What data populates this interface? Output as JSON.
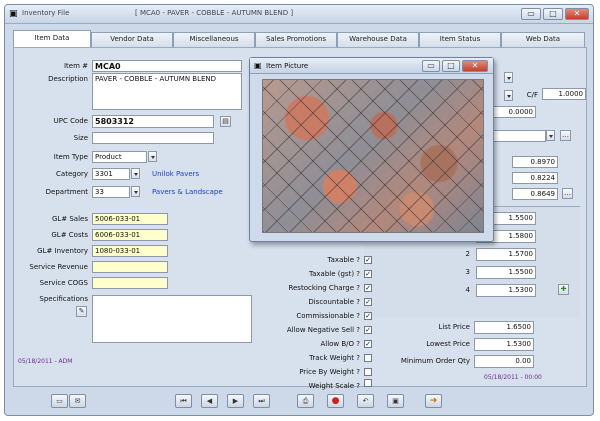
{
  "window": {
    "title": "Inventory File",
    "subtitle": "[ MCA0 - PAVER - COBBLE - AUTUMN BLEND ]"
  },
  "tabs": [
    "Item Data",
    "Vendor Data",
    "Miscellaneous",
    "Sales Promotions",
    "Warehouse Data",
    "Item Status",
    "Web Data"
  ],
  "left_form": {
    "item_no": {
      "label": "Item #",
      "value": "MCA0"
    },
    "description": {
      "label": "Description",
      "value": "PAVER - COBBLE - AUTUMN BLEND"
    },
    "upc": {
      "label": "UPC Code",
      "value": "5803312"
    },
    "size": {
      "label": "Size",
      "value": ""
    },
    "item_type": {
      "label": "Item Type",
      "value": "Product"
    },
    "category": {
      "label": "Category",
      "value": "3301",
      "link": "Unilok Pavers"
    },
    "department": {
      "label": "Department",
      "value": "33",
      "link": "Pavers & Landscape"
    },
    "gl_sales": {
      "label": "GL# Sales",
      "value": "5006-033-01"
    },
    "gl_costs": {
      "label": "GL# Costs",
      "value": "6006-033-01"
    },
    "gl_inventory": {
      "label": "GL# Inventory",
      "value": "1080-033-01"
    },
    "service_revenue": {
      "label": "Service Revenue",
      "value": ""
    },
    "service_cogs": {
      "label": "Service COGS",
      "value": ""
    },
    "specifications": {
      "label": "Specifications",
      "value": ""
    },
    "date_stamp": "05/18/2011 - ADM"
  },
  "popup": {
    "title": "Item Picture"
  },
  "right_top": {
    "conv_label": "C/F",
    "conv_value": "1.0000",
    "value_1": "0.0000"
  },
  "costs": [
    "0.8970",
    "0.8224",
    "0.8649"
  ],
  "prices": [
    "1.5500",
    "1.5800",
    "1.5700",
    "1.5500",
    "1.5300"
  ],
  "price_labels": [
    "",
    "",
    "2",
    "3",
    "4"
  ],
  "flags": [
    {
      "label": "Taxable ?",
      "checked": true
    },
    {
      "label": "Taxable (gst) ?",
      "checked": true
    },
    {
      "label": "Restocking Charge ?",
      "checked": true
    },
    {
      "label": "Discountable ?",
      "checked": true
    },
    {
      "label": "Commissionable ?",
      "checked": true
    },
    {
      "label": "Allow Negative Sell ?",
      "checked": true
    },
    {
      "label": "Allow B/O ?",
      "checked": true
    },
    {
      "label": "Track Weight ?",
      "checked": false
    },
    {
      "label": "Price By Weight ?",
      "checked": false
    },
    {
      "label": "Weight Scale ?",
      "checked": false
    }
  ],
  "pricing": {
    "list_price": {
      "label": "List Price",
      "value": "1.6500"
    },
    "lowest_price": {
      "label": "Lowest Price",
      "value": "1.5300"
    },
    "min_order": {
      "label": "Minimum Order Qty",
      "value": "0.00"
    },
    "date_stamp": "05/18/2011 - 00:00"
  },
  "colors": {
    "field_yellow": "#ffffcc",
    "link_blue": "#1b3fcc",
    "stamp_purple": "#6a2a8a",
    "panel": "#d7e1ee"
  }
}
